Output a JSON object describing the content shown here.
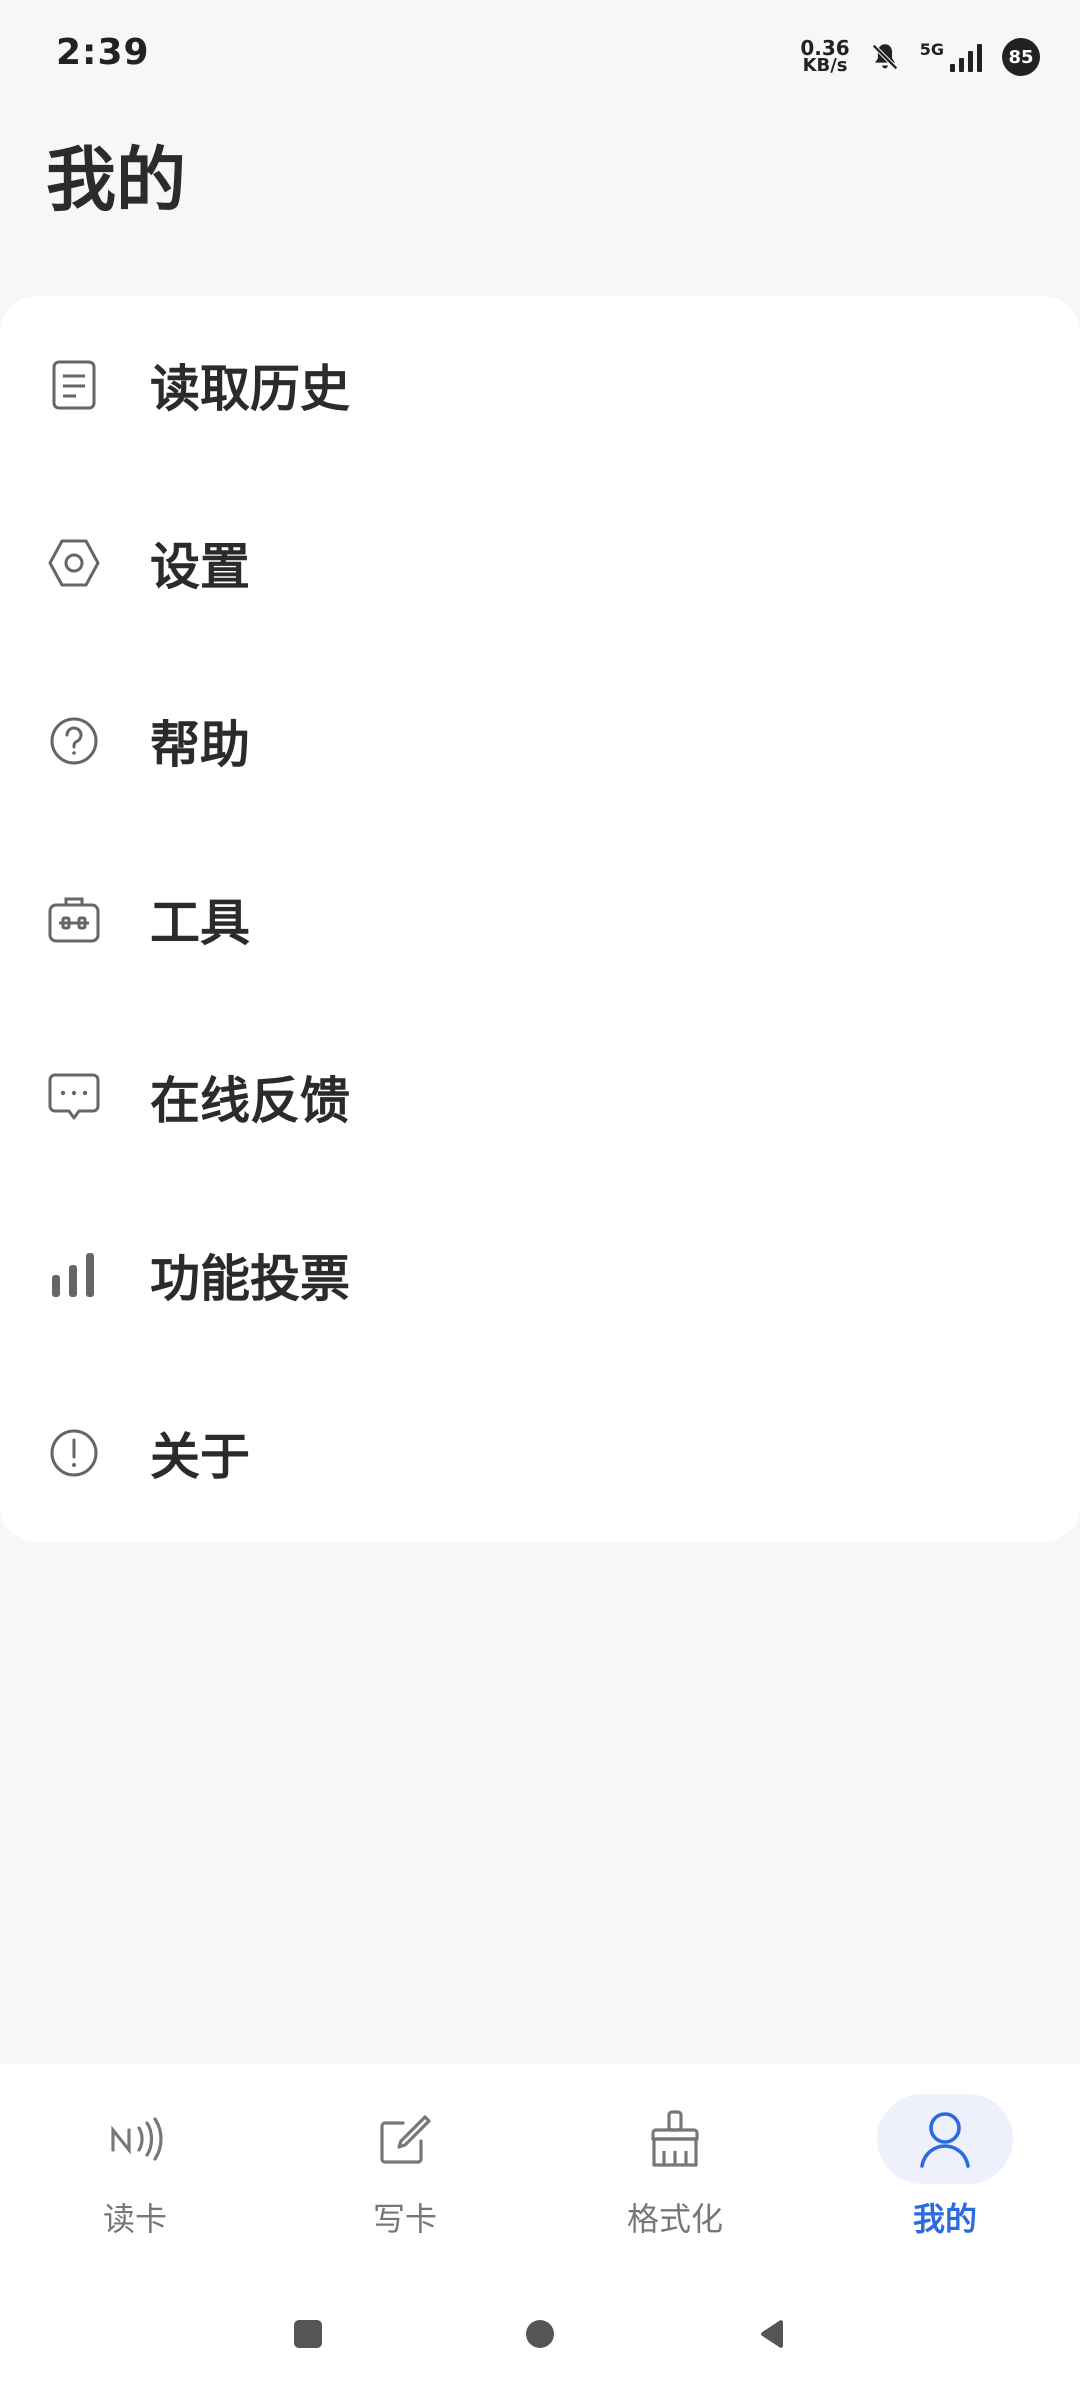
{
  "status_bar": {
    "time": "2:39",
    "net_speed_value": "0.36",
    "net_speed_unit": "KB/s",
    "network_type": "5G",
    "battery": "85"
  },
  "page": {
    "title": "我的"
  },
  "menu": {
    "items": [
      {
        "label": "读取历史",
        "icon": "document-icon"
      },
      {
        "label": "设置",
        "icon": "settings-hexagon-icon"
      },
      {
        "label": "帮助",
        "icon": "help-icon"
      },
      {
        "label": "工具",
        "icon": "toolbox-icon"
      },
      {
        "label": "在线反馈",
        "icon": "chat-bubble-icon"
      },
      {
        "label": "功能投票",
        "icon": "bar-chart-icon"
      },
      {
        "label": "关于",
        "icon": "info-exclamation-icon"
      }
    ]
  },
  "bottom_nav": {
    "tabs": [
      {
        "label": "读卡",
        "icon": "nfc-icon"
      },
      {
        "label": "写卡",
        "icon": "edit-icon"
      },
      {
        "label": "格式化",
        "icon": "brush-icon"
      },
      {
        "label": "我的",
        "icon": "person-icon",
        "active": true
      }
    ]
  },
  "colors": {
    "accent": "#2a6be0",
    "background": "#f7f7f9",
    "card": "#ffffff",
    "text": "#2b2b2b",
    "icon": "#666666"
  }
}
